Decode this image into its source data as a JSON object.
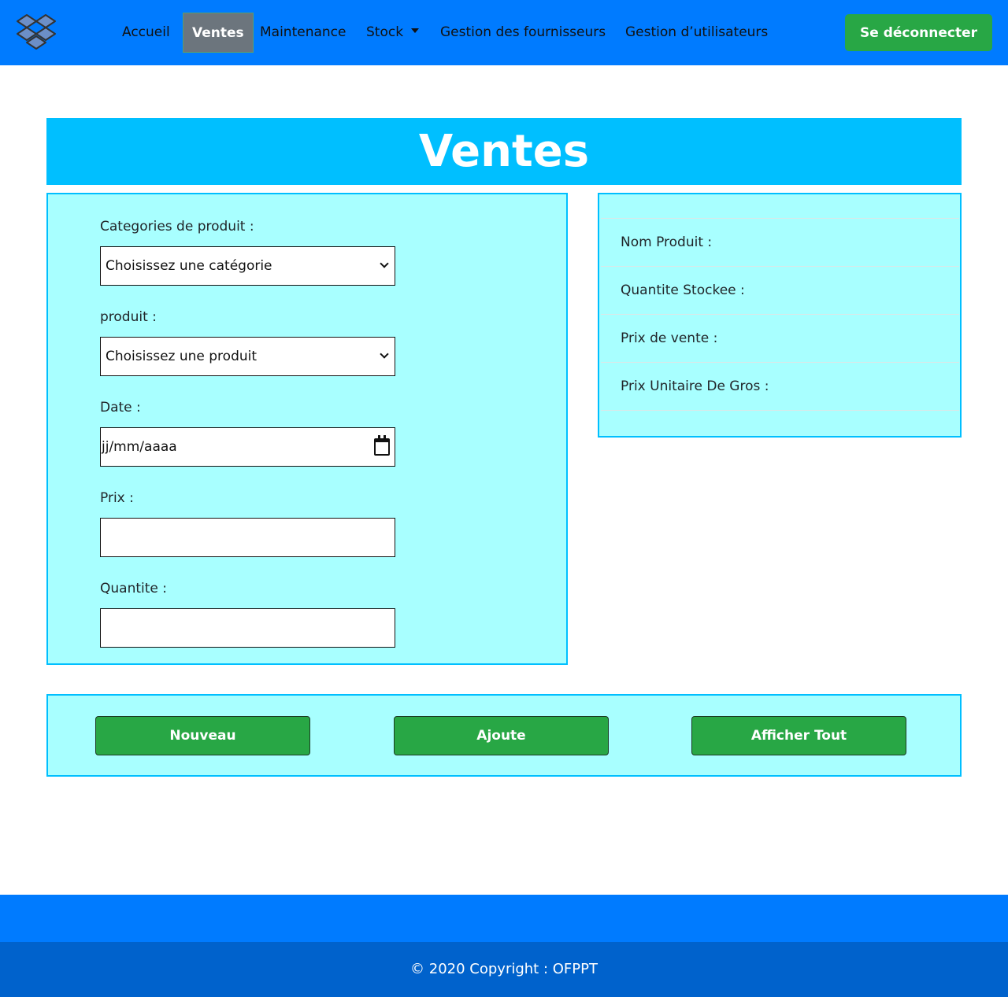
{
  "nav": {
    "logo_icon": "dropbox-like-box-icon",
    "items": [
      {
        "label": "Accueil"
      },
      {
        "label": "Ventes"
      },
      {
        "label": "Maintenance"
      },
      {
        "label": "Stock"
      },
      {
        "label": "Gestion des fournisseurs"
      },
      {
        "label": "Gestion d’utilisateurs"
      }
    ],
    "active": "Ventes",
    "logout_label": "Se déconnecter"
  },
  "page": {
    "title": "Ventes"
  },
  "form": {
    "category_label": "Categories de produit :",
    "category_value": "Choisissez une catégorie",
    "product_label": "produit :",
    "product_value": "Choisissez une produit",
    "date_label": "Date :",
    "date_placeholder": "jj/mm/aaaa",
    "price_label": "Prix :",
    "price_value": "",
    "quantity_label": "Quantite :",
    "quantity_value": ""
  },
  "info": {
    "rows": [
      {
        "label": "Nom Produit :"
      },
      {
        "label": "Quantite Stockee :"
      },
      {
        "label": "Prix de vente :"
      },
      {
        "label": "Prix Unitaire De Gros :"
      }
    ]
  },
  "actions": {
    "new_label": "Nouveau",
    "add_label": "Ajoute",
    "show_all_label": "Afficher Tout"
  },
  "footer": {
    "copyright": "© 2020 Copyright : OFPPT"
  },
  "colors": {
    "navbar": "#007bff",
    "banner": "#00bfff",
    "panel": "#a8ffff",
    "button": "#28a745",
    "footer_dark": "#0062cc"
  }
}
